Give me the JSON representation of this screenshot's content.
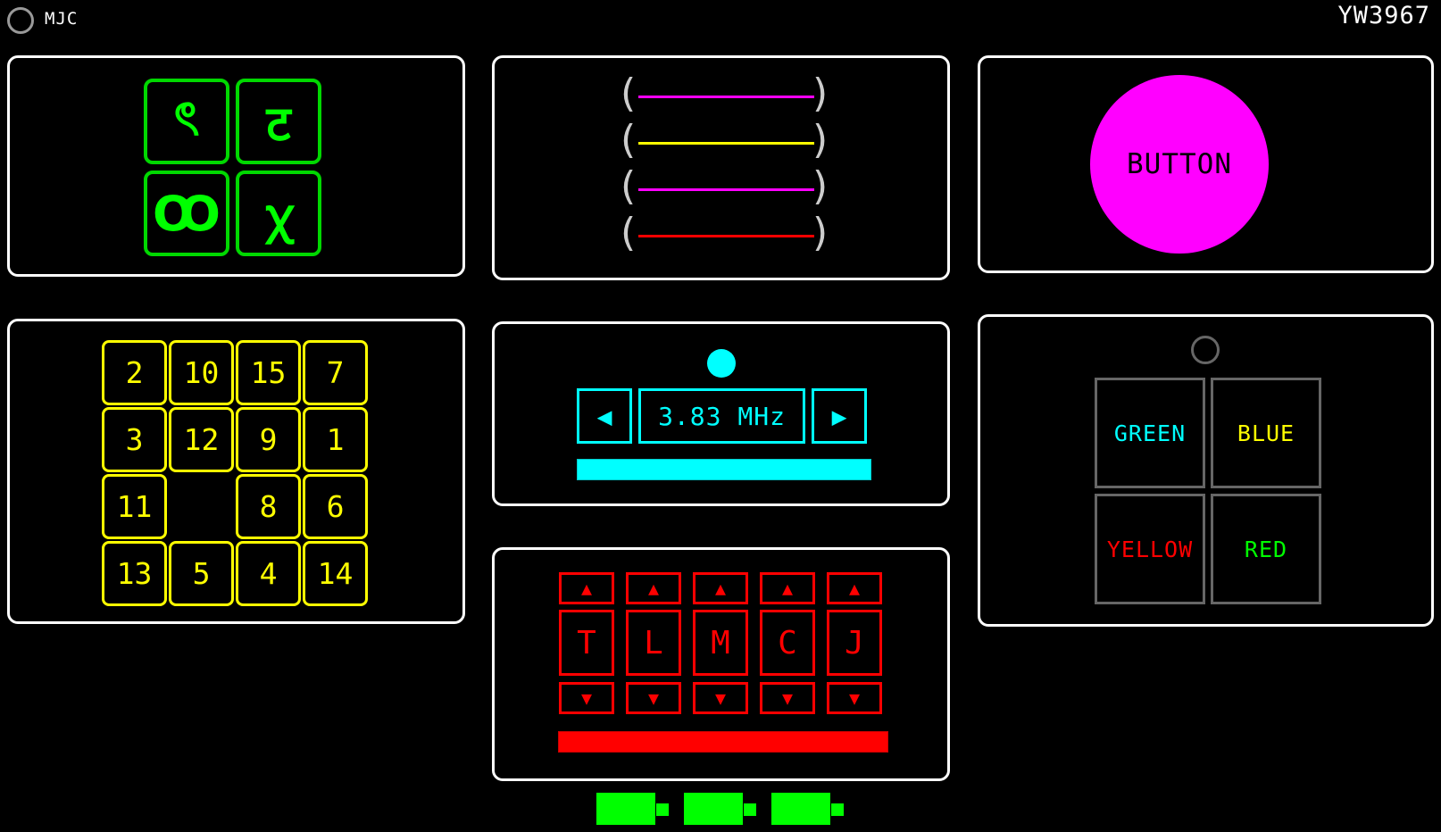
{
  "topbar": {
    "label": "MJC",
    "id": "YW3967"
  },
  "glyphs": [
    "ৎ",
    "ट",
    "Ꝏ",
    "ꭓ"
  ],
  "sliders": [
    {
      "color": "#ff00ff"
    },
    {
      "color": "#ffff00"
    },
    {
      "color": "#ff00ff"
    },
    {
      "color": "#ff0000"
    }
  ],
  "big_button": {
    "label": "BUTTON",
    "color": "#ff00ff"
  },
  "puzzle": {
    "rows": [
      [
        "2",
        "10",
        "15",
        "7"
      ],
      [
        "3",
        "12",
        "9",
        "1"
      ],
      [
        "11",
        "",
        "8",
        "6"
      ],
      [
        "13",
        "5",
        "4",
        "14"
      ]
    ]
  },
  "tuner": {
    "left_arrow": "◀",
    "right_arrow": "▶",
    "frequency": "3.83 MHz",
    "progress": 1.0
  },
  "color_grid": {
    "cells": [
      {
        "text": "GREEN",
        "color": "#00ffff"
      },
      {
        "text": "BLUE",
        "color": "#ffff00"
      },
      {
        "text": "YELLOW",
        "color": "#ff0000"
      },
      {
        "text": "RED",
        "color": "#00ff00"
      }
    ]
  },
  "letter_lock": {
    "up_arrow": "▲",
    "down_arrow": "▼",
    "letters": [
      "T",
      "L",
      "M",
      "C",
      "J"
    ],
    "progress": 1.0
  },
  "batteries": {
    "count": 3
  }
}
